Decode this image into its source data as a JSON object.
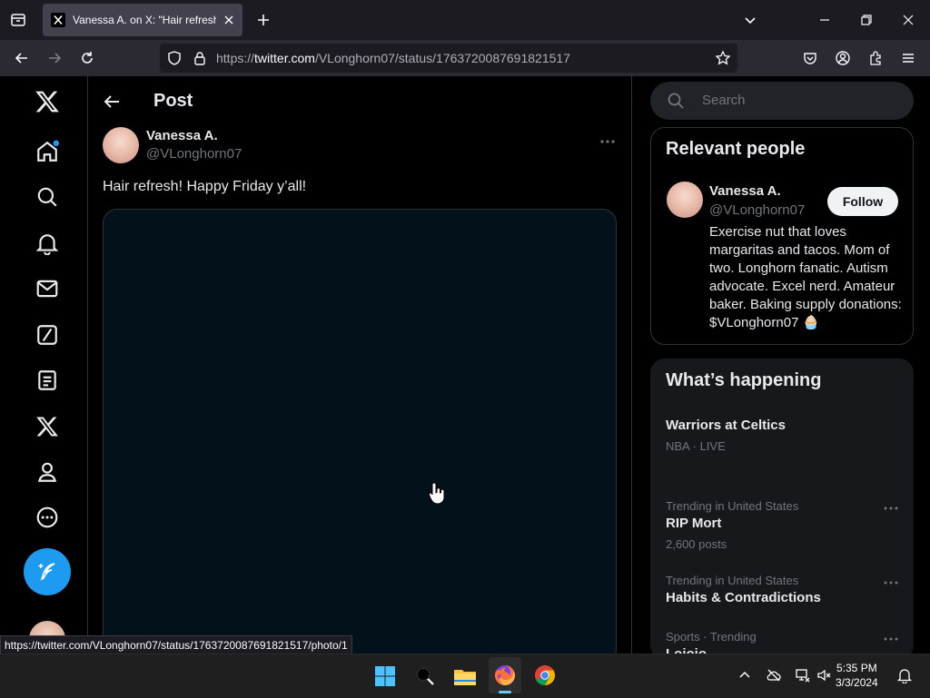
{
  "browser": {
    "tab_title": "Vanessa A. on X: \"Hair refresh! Happy Friday y'all!\"",
    "url_prefix": "https://",
    "url_domain": "twitter.com",
    "url_path": "/VLonghorn07/status/1763720087691821517",
    "status_link": "https://twitter.com/VLonghorn07/status/1763720087691821517/photo/1"
  },
  "nav": {
    "items": [
      "x-logo",
      "home-icon",
      "explore-icon",
      "notifications-icon",
      "messages-icon",
      "grok-icon",
      "lists-icon",
      "premium-icon",
      "profile-icon",
      "more-icon"
    ],
    "compose_icon": "feather-plus-icon"
  },
  "post": {
    "header_title": "Post",
    "author_name": "Vanessa A.",
    "author_handle": "@VLonghorn07",
    "text": "Hair refresh! Happy Friday y’all!"
  },
  "sidebar": {
    "search_placeholder": "Search",
    "relevant_title": "Relevant people",
    "person": {
      "name": "Vanessa A.",
      "handle": "@VLonghorn07",
      "follow_label": "Follow",
      "bio": "Exercise nut that loves margaritas and tacos. Mom of two. Longhorn fanatic. Autism advocate. Excel nerd. Amateur baker. Baking supply donations: $VLonghorn07 🧁"
    },
    "happening_title": "What’s happening",
    "trends": [
      {
        "name": "Warriors at Celtics",
        "meta": "NBA · LIVE"
      },
      {
        "category": "Trending in United States",
        "name": "RIP Mort",
        "meta": "2,600 posts"
      },
      {
        "category": "Trending in United States",
        "name": "Habits & Contradictions"
      },
      {
        "category": "Sports · Trending",
        "name": "Lojoio"
      }
    ]
  },
  "taskbar": {
    "time": "5:35 PM",
    "date": "3/3/2024"
  },
  "colors": {
    "accent": "#1d9bf0",
    "background": "#000000",
    "border": "#2f3336",
    "muted": "#71767b"
  }
}
